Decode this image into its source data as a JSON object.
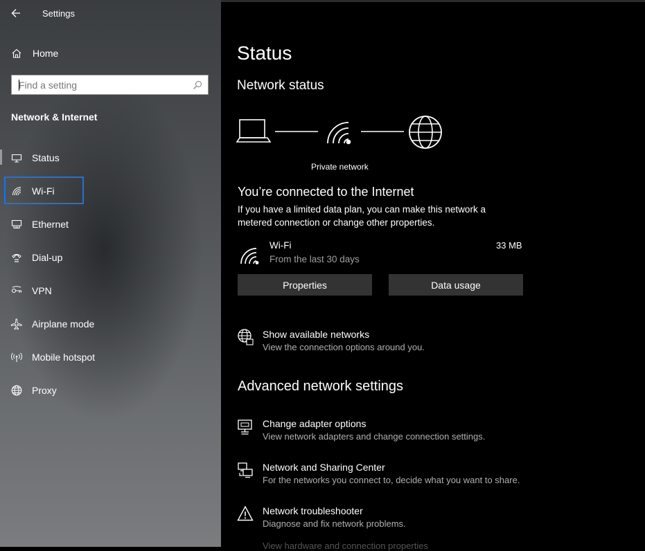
{
  "window": {
    "title": "Settings"
  },
  "sidebar": {
    "home_label": "Home",
    "search_placeholder": "Find a setting",
    "section_heading": "Network & Internet",
    "items": [
      {
        "label": "Status",
        "icon": "status-icon"
      },
      {
        "label": "Wi-Fi",
        "icon": "wifi-icon"
      },
      {
        "label": "Ethernet",
        "icon": "ethernet-icon"
      },
      {
        "label": "Dial-up",
        "icon": "dialup-icon"
      },
      {
        "label": "VPN",
        "icon": "vpn-icon"
      },
      {
        "label": "Airplane mode",
        "icon": "airplane-icon"
      },
      {
        "label": "Mobile hotspot",
        "icon": "hotspot-icon"
      },
      {
        "label": "Proxy",
        "icon": "globe-icon"
      }
    ]
  },
  "main": {
    "title": "Status",
    "network_status_heading": "Network status",
    "network_type": "Private network",
    "connected_title": "You’re connected to the Internet",
    "connected_desc": "If you have a limited data plan, you can make this network a metered connection or change other properties.",
    "connection": {
      "name": "Wi-Fi",
      "period": "From the last 30 days",
      "usage": "33 MB"
    },
    "buttons": {
      "properties": "Properties",
      "data_usage": "Data usage"
    },
    "show_networks": {
      "title": "Show available networks",
      "desc": "View the connection options around you."
    },
    "advanced_heading": "Advanced network settings",
    "advanced": [
      {
        "title": "Change adapter options",
        "desc": "View network adapters and change connection settings."
      },
      {
        "title": "Network and Sharing Center",
        "desc": "For the networks you connect to, decide what you want to share."
      },
      {
        "title": "Network troubleshooter",
        "desc": "Diagnose and fix network problems."
      }
    ],
    "cut_off_text": "View hardware and connection properties"
  },
  "colors": {
    "focus": "#1a73e8",
    "button": "#333333",
    "secondary_text": "#b0b0b0"
  }
}
